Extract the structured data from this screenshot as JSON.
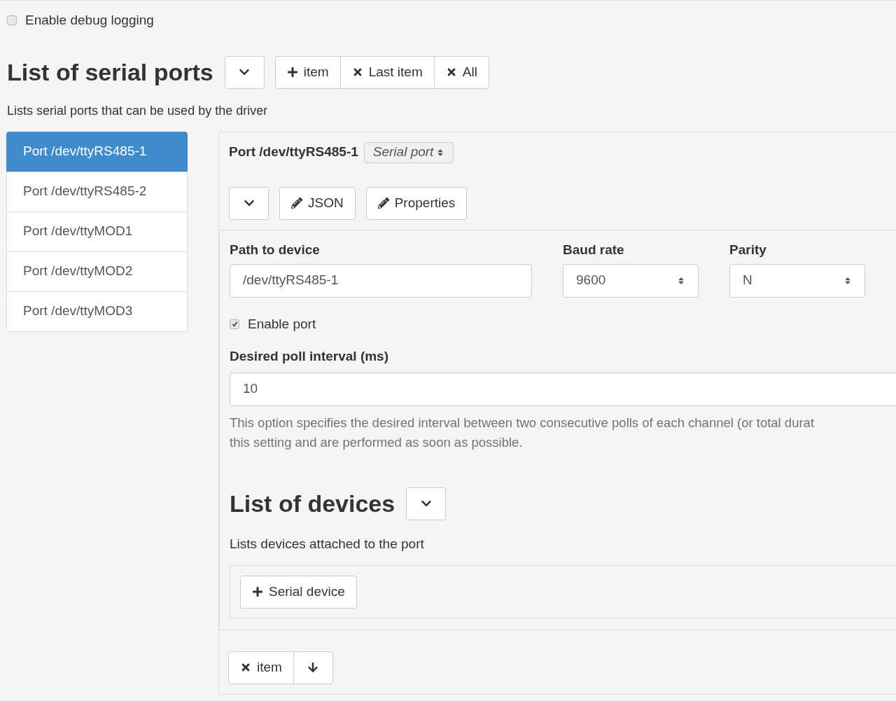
{
  "debug_option": {
    "label": "Enable debug logging",
    "checked": false
  },
  "ports_section": {
    "title": "List of serial ports",
    "description": "Lists serial ports that can be used by the driver",
    "toolbar": [
      {
        "kind": "add",
        "label": "item"
      },
      {
        "kind": "remove",
        "label": "Last item"
      },
      {
        "kind": "remove",
        "label": "All"
      }
    ]
  },
  "sidebar": {
    "items": [
      {
        "label": "Port /dev/ttyRS485-1",
        "selected": true
      },
      {
        "label": "Port /dev/ttyRS485-2",
        "selected": false
      },
      {
        "label": "Port /dev/ttyMOD1",
        "selected": false
      },
      {
        "label": "Port /dev/ttyMOD2",
        "selected": false
      },
      {
        "label": "Port /dev/ttyMOD3",
        "selected": false
      }
    ]
  },
  "port_panel": {
    "title": "Port /dev/ttyRS485-1",
    "type_select": "Serial port",
    "buttons": [
      {
        "kind": "collapse"
      },
      {
        "kind": "edit",
        "label": "JSON"
      },
      {
        "kind": "edit",
        "label": "Properties"
      }
    ],
    "path": {
      "label": "Path to device",
      "value": "/dev/ttyRS485-1"
    },
    "baud_rate": {
      "label": "Baud rate",
      "value": "9600"
    },
    "parity": {
      "label": "Parity",
      "value": "N"
    },
    "enable_port": {
      "label": "Enable port",
      "checked": true
    },
    "poll_interval": {
      "label": "Desired poll interval (ms)",
      "value": "10",
      "help": [
        "This option specifies the desired interval between two consecutive polls of each channel (or total durat",
        "this setting and are performed as soon as possible."
      ]
    },
    "devices": {
      "title": "List of devices",
      "description": "Lists devices attached to the port",
      "add_button": "Serial device"
    },
    "footer_buttons": [
      {
        "kind": "remove",
        "label": "item"
      },
      {
        "kind": "move-down"
      }
    ]
  }
}
